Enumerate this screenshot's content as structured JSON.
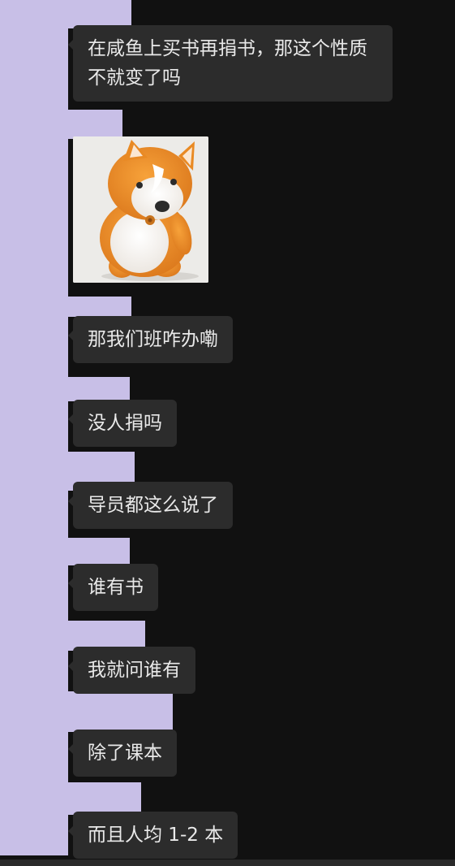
{
  "messages": [
    {
      "type": "text",
      "text": "在咸鱼上买书再捐书，那这个性质不就变了吗"
    },
    {
      "type": "sticker",
      "icon": "corgi-sticker-icon"
    },
    {
      "type": "text",
      "text": "那我们班咋办嘞"
    },
    {
      "type": "text",
      "text": "没人捐吗"
    },
    {
      "type": "text",
      "text": "导员都这么说了"
    },
    {
      "type": "text",
      "text": "谁有书"
    },
    {
      "type": "text",
      "text": "我就问谁有"
    },
    {
      "type": "text",
      "text": "除了课本"
    },
    {
      "type": "text",
      "text": "而且人均 1-2 本"
    }
  ],
  "colors": {
    "background": "#111111",
    "bubble": "#2c2c2c",
    "bubble_text": "#e9e9e9",
    "redaction": "#c8bfe7"
  }
}
